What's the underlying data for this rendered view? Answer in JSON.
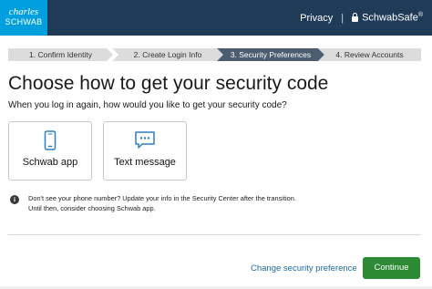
{
  "header": {
    "logo_line1": "charles",
    "logo_line2": "SCHWAB",
    "privacy_label": "Privacy",
    "separator": "|",
    "schwabsafe_label": "SchwabSafe",
    "schwabsafe_mark": "®"
  },
  "steps": [
    {
      "label": "1. Confirm Identity",
      "active": false
    },
    {
      "label": "2. Create Login Info",
      "active": false
    },
    {
      "label": "3. Security Preferences",
      "active": true
    },
    {
      "label": "4. Review Accounts",
      "active": false
    }
  ],
  "page": {
    "title": "Choose how to get your security code",
    "subtitle": "When you log in again, how would you like to get your security code?"
  },
  "options": [
    {
      "label": "Schwab app",
      "icon": "phone-icon"
    },
    {
      "label": "Text message",
      "icon": "chat-bubble-icon"
    }
  ],
  "info": {
    "line1": "Don't see your phone number? Update your info in the Security Center after the transition.",
    "line2": "Until then, consider choosing Schwab app."
  },
  "footer": {
    "change_link": "Change security preference",
    "continue_label": "Continue"
  },
  "colors": {
    "header_bg": "#1f3b57",
    "logo_bg": "#00a0df",
    "active_step": "#4b5d6f",
    "accent_blue": "#2e7fc0",
    "continue_green": "#2c8a35"
  }
}
